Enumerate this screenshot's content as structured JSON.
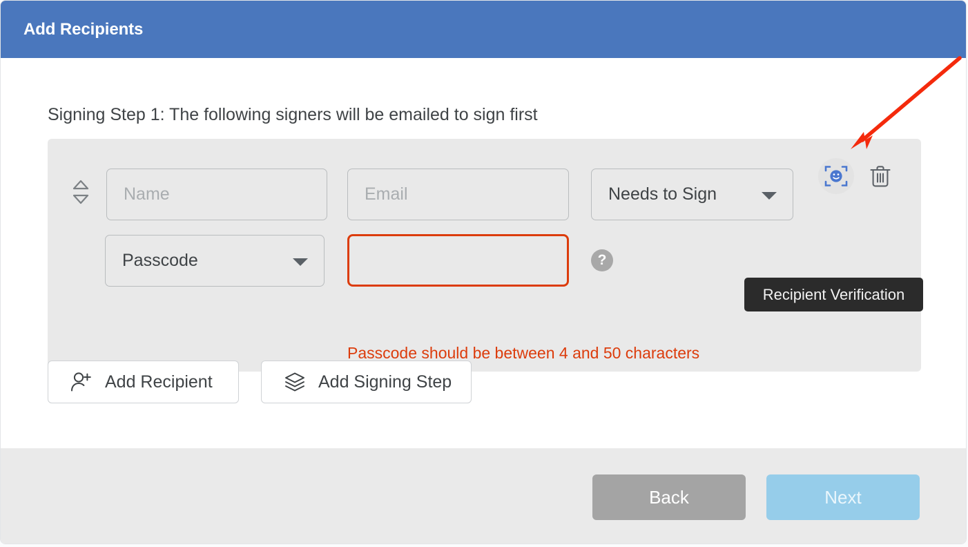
{
  "header": {
    "title": "Add Recipients",
    "background_color": "#4a77bd"
  },
  "body": {
    "step_heading": "Signing Step 1: The following signers will be emailed to sign first"
  },
  "recipient_row": {
    "drag_handle_icon": "drag-updown-icon",
    "name_field": {
      "placeholder": "Name",
      "value": ""
    },
    "email_field": {
      "placeholder": "Email",
      "value": ""
    },
    "role_select": {
      "selected": "Needs to Sign",
      "caret_icon": "chevron-down-icon"
    },
    "auth_select": {
      "selected": "Passcode",
      "caret_icon": "chevron-down-icon"
    },
    "passcode_input": {
      "value": "",
      "placeholder": "",
      "error_state": true,
      "error_border_color": "#dc3c0c"
    },
    "help_icon": {
      "glyph": "?",
      "name": "help-question-icon"
    },
    "error_message": "Passcode should be between 4 and 50 characters",
    "error_color": "#dc3c0c",
    "verify_button": {
      "icon": "face-scan-verification-icon",
      "accent_color": "#4a77cf"
    },
    "delete_button": {
      "icon": "trash-delete-icon"
    }
  },
  "tooltip": {
    "text": "Recipient Verification",
    "background_color": "#2b2b2b"
  },
  "actions": {
    "add_recipient": {
      "label": "Add Recipient",
      "icon": "add-person-icon"
    },
    "add_signing_step": {
      "label": "Add Signing Step",
      "icon": "layers-stack-icon"
    }
  },
  "footer": {
    "back_label": "Back",
    "next_label": "Next",
    "back_color": "#a4a4a4",
    "next_color": "#96cdea"
  },
  "annotation": {
    "arrow_color": "#f42a0c",
    "points_to": "verify_button"
  }
}
